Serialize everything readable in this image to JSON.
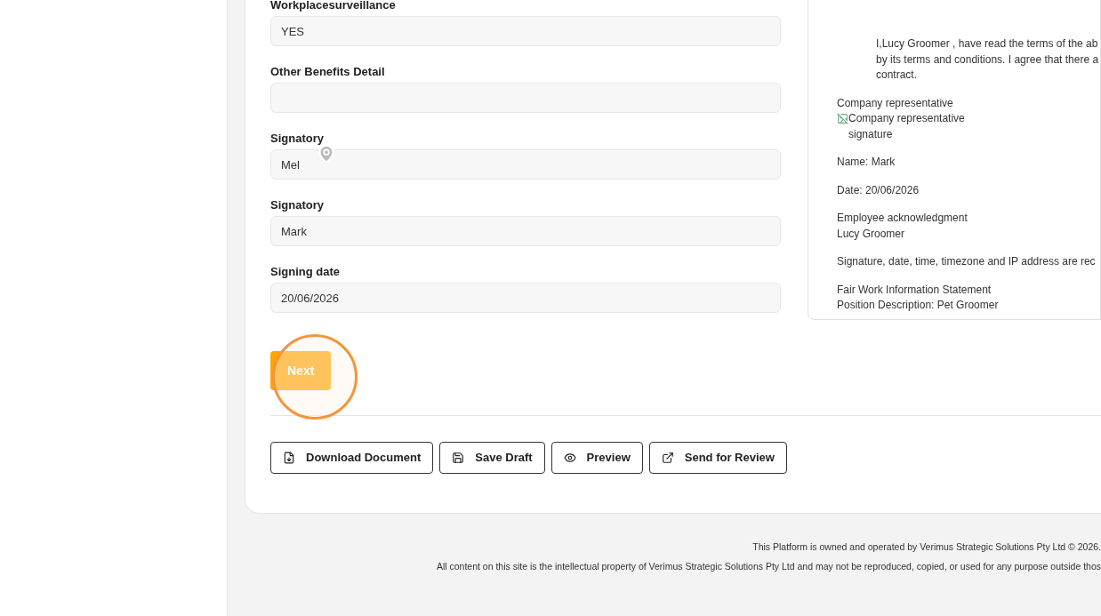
{
  "form": {
    "fields": [
      {
        "label": "Workplacesurveillance",
        "value": "YES"
      },
      {
        "label": "Other Benefits Detail"
      },
      {
        "label": "Signatory",
        "value": "Mel"
      },
      {
        "label": "Signatory",
        "value": "Mark"
      },
      {
        "label": "Signing date",
        "value": "20/06/2026"
      }
    ],
    "next_button": "Next",
    "actions": [
      {
        "kind": "download",
        "label": "Download Document"
      },
      {
        "kind": "save",
        "label": "Save Draft"
      },
      {
        "kind": "preview",
        "label": "Preview"
      },
      {
        "kind": "send",
        "label": "Send for Review"
      }
    ]
  },
  "preview": {
    "agreement_lines": [
      "I,Lucy Groomer , have read the terms of the ab",
      "by its terms and conditions. I agree that there a",
      "contract."
    ],
    "company_rep_label": "Company representative",
    "signature_alt": "Company representative signature",
    "name": "Name: Mark",
    "date": "Date: 20/06/2026",
    "employee_label": "Employee acknowledgment",
    "employee_name": "Lucy Groomer",
    "record_note": "Signature, date, time, timezone and IP address are rec",
    "attachments": [
      "Fair Work Information Statement",
      "Position Description: Pet Groomer"
    ]
  },
  "footer": [
    "This Platform is owned and operated by Verimus Strategic Solutions Pty Ltd © 2026.",
    "All content on this site is the intellectual property of Verimus Strategic Solutions Pty Ltd and may not be reproduced, copied, or used for any purpose outside thos"
  ]
}
